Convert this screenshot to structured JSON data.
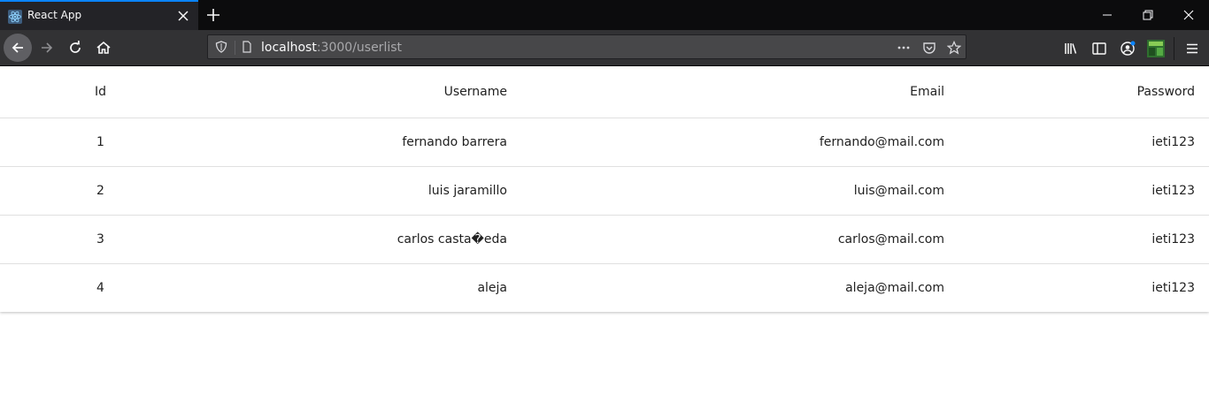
{
  "browser": {
    "tab": {
      "title": "React App",
      "favicon": "react-atom-icon"
    },
    "url": {
      "host": "localhost",
      "rest": ":3000/userlist"
    },
    "icons": [
      "back-icon",
      "forward-icon",
      "reload-icon",
      "home-icon",
      "shield-icon",
      "page-icon",
      "more-icon",
      "pocket-icon",
      "bookmark-star-icon",
      "library-icon",
      "sidebar-icon",
      "account-icon",
      "extension-icon",
      "menu-icon",
      "minimize-icon",
      "restore-icon",
      "close-icon"
    ],
    "colors": {
      "tab_accent": "#0a84ff",
      "tabstrip_bg": "#0c0c0d",
      "navbar_bg": "#323234"
    }
  },
  "table": {
    "headers": {
      "id": "Id",
      "username": "Username",
      "email": "Email",
      "password": "Password"
    },
    "rows": [
      {
        "id": "1",
        "username": "fernando barrera",
        "email": "fernando@mail.com",
        "password": "ieti123"
      },
      {
        "id": "2",
        "username": "luis jaramillo",
        "email": "luis@mail.com",
        "password": "ieti123"
      },
      {
        "id": "3",
        "username": "carlos casta�eda",
        "email": "carlos@mail.com",
        "password": "ieti123"
      },
      {
        "id": "4",
        "username": "aleja",
        "email": "aleja@mail.com",
        "password": "ieti123"
      }
    ]
  }
}
